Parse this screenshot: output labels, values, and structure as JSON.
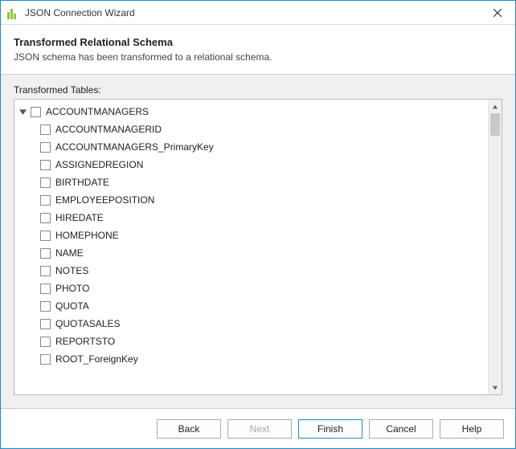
{
  "window": {
    "title": "JSON Connection Wizard"
  },
  "header": {
    "heading": "Transformed Relational Schema",
    "subtext": "JSON schema has been transformed to a relational schema."
  },
  "body": {
    "label": "Transformed Tables:",
    "root": {
      "label": "ACCOUNTMANAGERS",
      "expanded": true
    },
    "columns": [
      "ACCOUNTMANAGERID",
      "ACCOUNTMANAGERS_PrimaryKey",
      "ASSIGNEDREGION",
      "BIRTHDATE",
      "EMPLOYEEPOSITION",
      "HIREDATE",
      "HOMEPHONE",
      "NAME",
      "NOTES",
      "PHOTO",
      "QUOTA",
      "QUOTASALES",
      "REPORTSTO",
      "ROOT_ForeignKey"
    ]
  },
  "buttons": {
    "back": "Back",
    "next": "Next",
    "finish": "Finish",
    "cancel": "Cancel",
    "help": "Help"
  }
}
